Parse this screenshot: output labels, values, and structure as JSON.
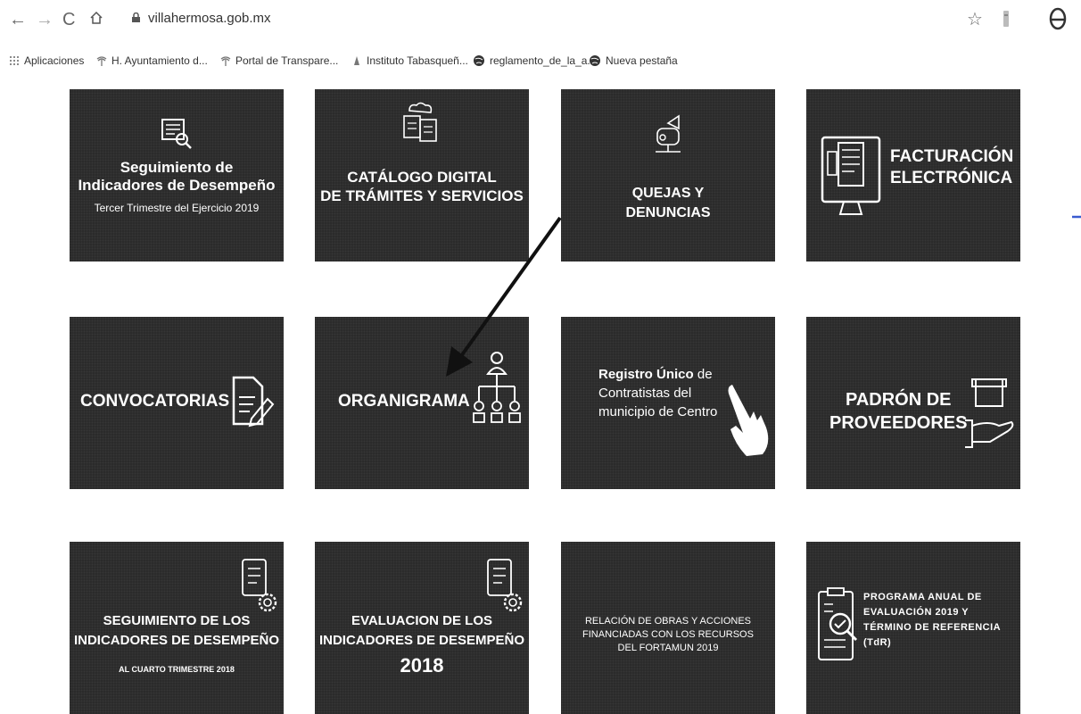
{
  "browser": {
    "url": "villahermosa.gob.mx",
    "bookmarks": [
      {
        "label": "Aplicaciones"
      },
      {
        "label": "H. Ayuntamiento d..."
      },
      {
        "label": "Portal de Transpare..."
      },
      {
        "label": "Instituto Tabasqueñ..."
      },
      {
        "label": "reglamento_de_la_a..."
      },
      {
        "label": "Nueva pestaña"
      }
    ]
  },
  "tiles": [
    {
      "title_line1": "Seguimiento de",
      "title_line2": "Indicadores de Desempeño",
      "subtitle": "Tercer Trimestre del Ejercicio 2019",
      "icon": "keyboard-search-icon"
    },
    {
      "title_line1": "CATÁLOGO DIGITAL",
      "title_line2": "DE TRÁMITES Y SERVICIOS",
      "icon": "documents-cloud-icon"
    },
    {
      "title_line1": "QUEJAS Y",
      "title_line2": "DENUNCIAS",
      "icon": "megaphone-mailbox-icon"
    },
    {
      "title_line1": "FACTURACIÓN",
      "title_line2": "ELECTRÓNICA",
      "icon": "computer-invoice-icon"
    },
    {
      "title_line1": "CONVOCATORIAS",
      "icon": "document-pencil-icon"
    },
    {
      "title_line1": "ORGANIGRAMA",
      "icon": "org-chart-icon"
    },
    {
      "title_line1": "Registro Único",
      "title_line1b": " de",
      "title_line2": "Contratistas del",
      "title_line3": "municipio de Centro",
      "icon": "hand-pointer-icon"
    },
    {
      "title_line1": "PADRÓN DE",
      "title_line2": "PROVEEDORES",
      "icon": "hand-box-icon"
    },
    {
      "title_line1": "SEGUIMIENTO DE LOS",
      "title_line2": "INDICADORES DE DESEMPEÑO",
      "subtitle": "AL CUARTO TRIMESTRE 2018",
      "icon": "checklist-gear-icon"
    },
    {
      "title_line1": "EVALUACION DE LOS",
      "title_line2": "INDICADORES DE DESEMPEÑO",
      "title_line3": "2018",
      "icon": "checklist-gear-icon"
    },
    {
      "title_line1": "RELACIÓN DE OBRAS Y ACCIONES",
      "title_line2": "FINANCIADAS CON LOS RECURSOS",
      "title_line3": "DEL FORTAMUN 2019"
    },
    {
      "title_line1": "PROGRAMA ANUAL DE",
      "title_line2": "EVALUACIÓN 2019 Y",
      "title_line3": "TÉRMINO DE REFERENCIA",
      "title_line4": "(TdR)",
      "icon": "clipboard-magnifier-icon"
    }
  ],
  "colors": {
    "tile_bg": "#2b2b2b",
    "text": "#ffffff",
    "accent_mark": "#3a5bd0"
  }
}
